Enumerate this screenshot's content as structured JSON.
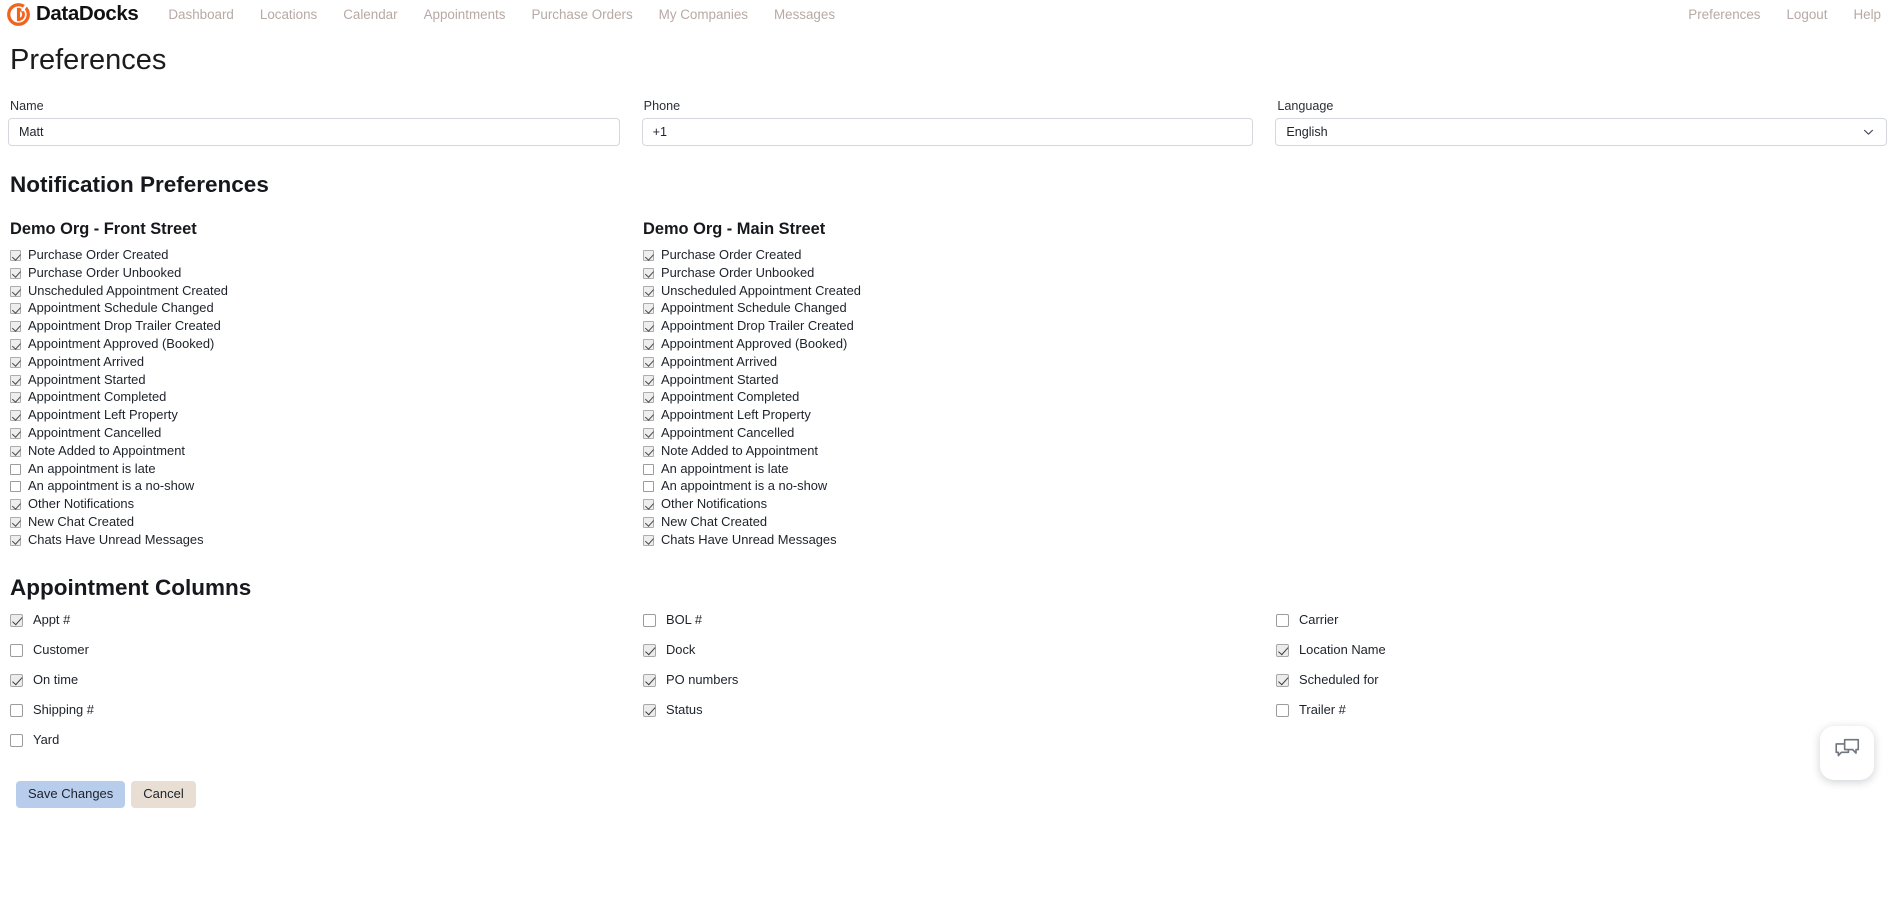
{
  "brand": {
    "name": "DataDocks",
    "logo_icon": "datadocks-logo-icon",
    "accent_color": "#f1641e"
  },
  "nav": {
    "left": [
      "Dashboard",
      "Locations",
      "Calendar",
      "Appointments",
      "Purchase Orders",
      "My Companies",
      "Messages"
    ],
    "right": [
      "Preferences",
      "Logout",
      "Help"
    ]
  },
  "page": {
    "title": "Preferences"
  },
  "profile": {
    "name_label": "Name",
    "name_value": "Matt",
    "name_placeholder": "Name",
    "phone_label": "Phone",
    "phone_value": "+1",
    "phone_placeholder": "+1",
    "language_label": "Language",
    "language_value": "English",
    "language_options": [
      "English"
    ],
    "chevron_icon": "chevron-down-icon"
  },
  "notifications": {
    "section_title": "Notification Preferences",
    "groups": [
      {
        "title": "Demo Org - Front Street",
        "items": [
          {
            "label": "Purchase Order Created",
            "checked": true
          },
          {
            "label": "Purchase Order Unbooked",
            "checked": true
          },
          {
            "label": "Unscheduled Appointment Created",
            "checked": true
          },
          {
            "label": "Appointment Schedule Changed",
            "checked": true
          },
          {
            "label": "Appointment Drop Trailer Created",
            "checked": true
          },
          {
            "label": "Appointment Approved (Booked)",
            "checked": true
          },
          {
            "label": "Appointment Arrived",
            "checked": true
          },
          {
            "label": "Appointment Started",
            "checked": true
          },
          {
            "label": "Appointment Completed",
            "checked": true
          },
          {
            "label": "Appointment Left Property",
            "checked": true
          },
          {
            "label": "Appointment Cancelled",
            "checked": true
          },
          {
            "label": "Note Added to Appointment",
            "checked": true
          },
          {
            "label": "An appointment is late",
            "checked": false
          },
          {
            "label": "An appointment is a no-show",
            "checked": false
          },
          {
            "label": "Other Notifications",
            "checked": true
          },
          {
            "label": "New Chat Created",
            "checked": true
          },
          {
            "label": "Chats Have Unread Messages",
            "checked": true
          }
        ]
      },
      {
        "title": "Demo Org - Main Street",
        "items": [
          {
            "label": "Purchase Order Created",
            "checked": true
          },
          {
            "label": "Purchase Order Unbooked",
            "checked": true
          },
          {
            "label": "Unscheduled Appointment Created",
            "checked": true
          },
          {
            "label": "Appointment Schedule Changed",
            "checked": true
          },
          {
            "label": "Appointment Drop Trailer Created",
            "checked": true
          },
          {
            "label": "Appointment Approved (Booked)",
            "checked": true
          },
          {
            "label": "Appointment Arrived",
            "checked": true
          },
          {
            "label": "Appointment Started",
            "checked": true
          },
          {
            "label": "Appointment Completed",
            "checked": true
          },
          {
            "label": "Appointment Left Property",
            "checked": true
          },
          {
            "label": "Appointment Cancelled",
            "checked": true
          },
          {
            "label": "Note Added to Appointment",
            "checked": true
          },
          {
            "label": "An appointment is late",
            "checked": false
          },
          {
            "label": "An appointment is a no-show",
            "checked": false
          },
          {
            "label": "Other Notifications",
            "checked": true
          },
          {
            "label": "New Chat Created",
            "checked": true
          },
          {
            "label": "Chats Have Unread Messages",
            "checked": true
          }
        ]
      }
    ]
  },
  "appointment_columns": {
    "section_title": "Appointment Columns",
    "columns": [
      [
        {
          "label": "Appt #",
          "checked": true
        },
        {
          "label": "Customer",
          "checked": false
        },
        {
          "label": "On time",
          "checked": true
        },
        {
          "label": "Shipping #",
          "checked": false
        },
        {
          "label": "Yard",
          "checked": false
        }
      ],
      [
        {
          "label": "BOL #",
          "checked": false
        },
        {
          "label": "Dock",
          "checked": true
        },
        {
          "label": "PO numbers",
          "checked": true
        },
        {
          "label": "Status",
          "checked": true
        }
      ],
      [
        {
          "label": "Carrier",
          "checked": false
        },
        {
          "label": "Location Name",
          "checked": true
        },
        {
          "label": "Scheduled for",
          "checked": true
        },
        {
          "label": "Trailer #",
          "checked": false
        }
      ]
    ]
  },
  "footer": {
    "save_label": "Save Changes",
    "cancel_label": "Cancel",
    "save_color": "#b8cdec",
    "cancel_color": "#e8ded3"
  },
  "chat_widget": {
    "icon": "chat-bubbles-icon"
  }
}
